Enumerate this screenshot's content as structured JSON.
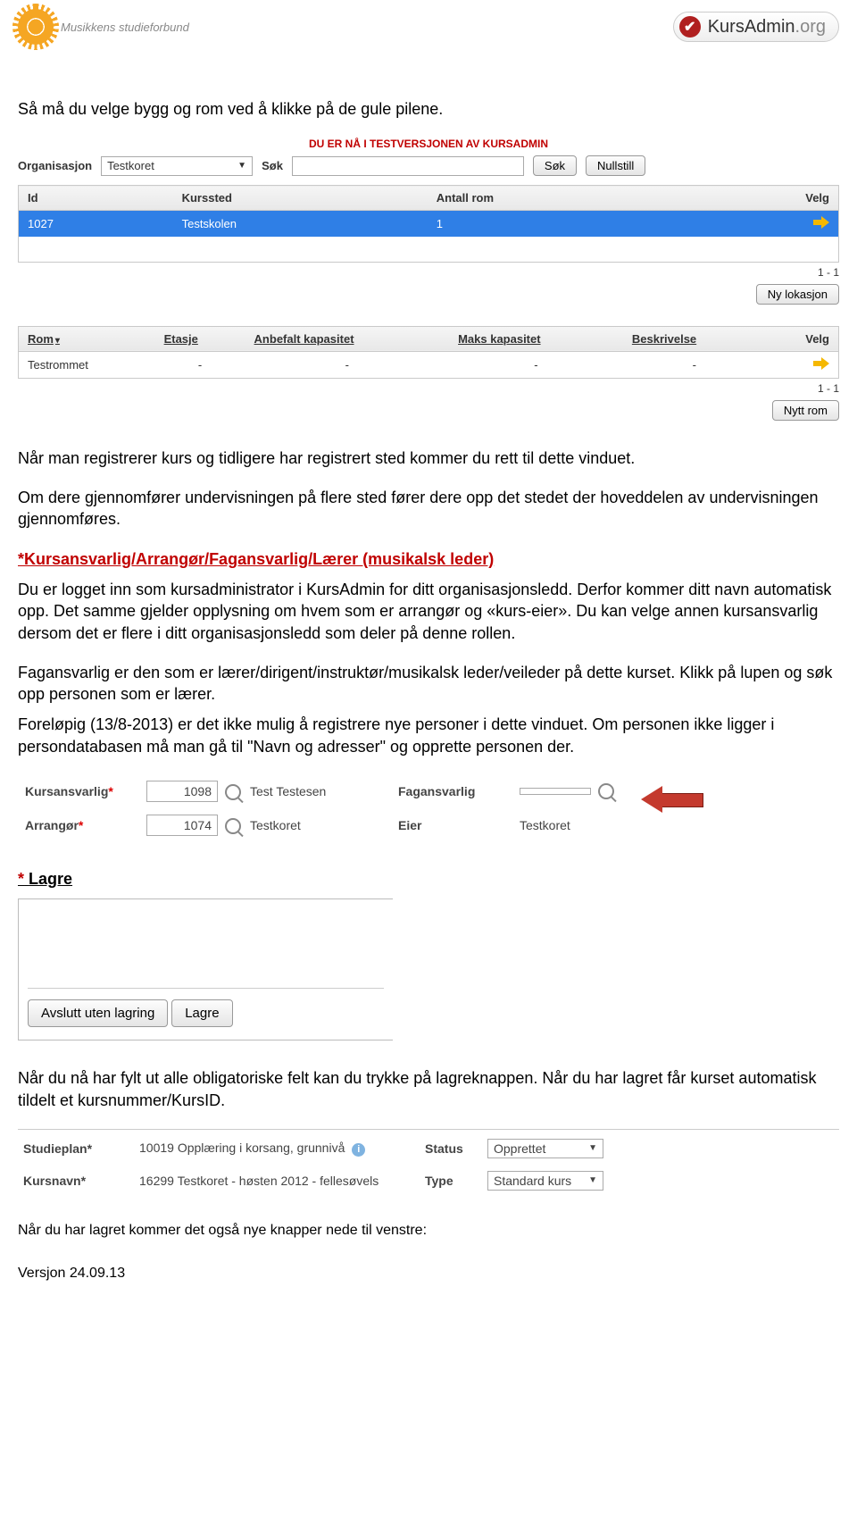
{
  "header": {
    "left_logo_text": "Musikkens studieforbund",
    "right_logo_main": "KursAdmin",
    "right_logo_suffix": ".org"
  },
  "intro_1": "Så må du velge bygg og rom ved å klikke på de gule pilene.",
  "panel1": {
    "banner": "DU ER NÅ I TESTVERSJONEN AV KURSADMIN",
    "org_label": "Organisasjon",
    "org_value": "Testkoret",
    "search_label": "Søk",
    "search_btn": "Søk",
    "reset_btn": "Nullstill",
    "table1": {
      "headers": [
        "Id",
        "Kurssted",
        "Antall rom",
        "Velg"
      ],
      "rows": [
        {
          "id": "1027",
          "sted": "Testskolen",
          "rom": "1"
        }
      ],
      "count": "1 - 1",
      "new_btn": "Ny lokasjon"
    },
    "table2": {
      "headers": [
        "Rom",
        "Etasje",
        "Anbefalt kapasitet",
        "Maks kapasitet",
        "Beskrivelse",
        "Velg"
      ],
      "rows": [
        {
          "rom": "Testrommet",
          "etasje": "-",
          "anb": "-",
          "maks": "-",
          "besk": "-"
        }
      ],
      "count": "1 - 1",
      "new_btn": "Nytt rom"
    }
  },
  "para2a": "Når man registrerer kurs og tidligere har registrert sted kommer du rett til dette vinduet.",
  "para2b": "Om dere gjennomfører undervisningen på flere sted fører dere opp det stedet der hoveddelen av undervisningen gjennomføres.",
  "heading_red": "*Kursansvarlig/Arrangør/Fagansvarlig/Lærer (musikalsk leder)",
  "para3": "Du er logget inn som kursadministrator i KursAdmin for ditt organisasjonsledd. Derfor kommer ditt navn automatisk opp. Det samme gjelder opplysning om hvem som er arrangør og «kurs-eier». Du kan velge annen kursansvarlig dersom det er flere i ditt organisasjonsledd som deler på denne rollen.",
  "para4": "Fagansvarlig er den som er lærer/dirigent/instruktør/musikalsk leder/veileder på dette kurset. Klikk på lupen og søk opp personen som er lærer.",
  "para5": "Foreløpig (13/8-2013) er det ikke mulig å registrere nye personer i dette vinduet. Om personen ikke ligger i persondatabasen må man gå til \"Navn og adresser\" og opprette personen der.",
  "formpanel": {
    "kursansvarlig_label": "Kursansvarlig",
    "kursansvarlig_id": "1098",
    "kursansvarlig_name": "Test Testesen",
    "fagansvarlig_label": "Fagansvarlig",
    "arrangor_label": "Arrangør",
    "arrangor_id": "1074",
    "arrangor_name": "Testkoret",
    "eier_label": "Eier",
    "eier_name": "Testkoret"
  },
  "lagre_heading": "* Lagre",
  "lagre_box": {
    "avslutt": "Avslutt uten lagring",
    "lagre": "Lagre"
  },
  "para6": "Når du nå har fylt ut alle obligatoriske felt kan du trykke på lagreknappen. Når du har lagret får kurset automatisk tildelt et kursnummer/KursID.",
  "statuspanel": {
    "studieplan_label": "Studieplan",
    "studieplan_val": "10019 Opplæring i korsang, grunnivå",
    "status_label": "Status",
    "status_val": "Opprettet",
    "kursnavn_label": "Kursnavn",
    "kursnavn_val": "16299 Testkoret - høsten 2012 - fellesøvels",
    "type_label": "Type",
    "type_val": "Standard kurs"
  },
  "para7": "Når du har lagret kommer det også nye knapper nede til venstre:",
  "version": "Versjon 24.09.13"
}
